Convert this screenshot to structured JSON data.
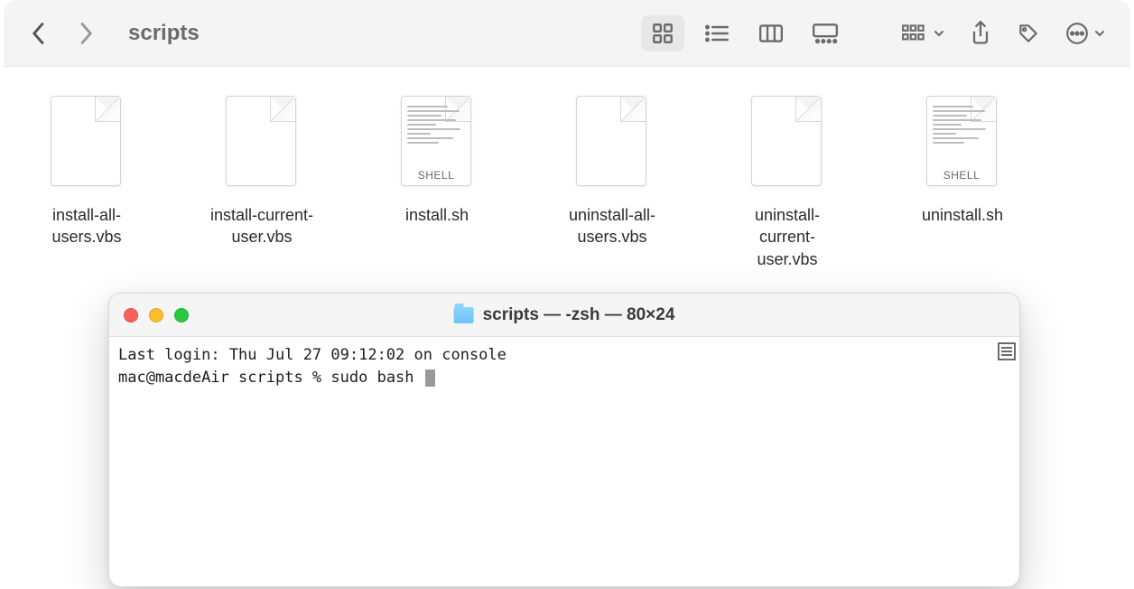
{
  "finder": {
    "title": "scripts",
    "files": [
      {
        "name": "install-all-users.vbs",
        "type": "generic"
      },
      {
        "name": "install-current-user.vbs",
        "type": "generic"
      },
      {
        "name": "install.sh",
        "type": "shell",
        "badge": "SHELL"
      },
      {
        "name": "uninstall-all-users.vbs",
        "type": "generic"
      },
      {
        "name": "uninstall-current-user.vbs",
        "type": "generic"
      },
      {
        "name": "uninstall.sh",
        "type": "shell",
        "badge": "SHELL"
      }
    ]
  },
  "terminal": {
    "title": "scripts — -zsh — 80×24",
    "line1": "Last login: Thu Jul 27 09:12:02 on console",
    "prompt": "mac@macdeAir scripts % ",
    "command": "sudo bash "
  }
}
